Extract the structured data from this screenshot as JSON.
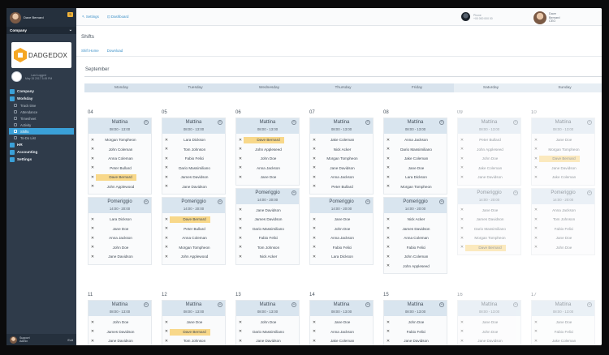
{
  "sidebar": {
    "user_name": "Dave Bernard",
    "notification_count": "5",
    "company_label": "Company",
    "logo_text": "DADGEDOX",
    "login_text": "Last Logged\nMay 15 2017 3:45 PM",
    "nav": [
      {
        "label": "Company",
        "icon": "building-icon"
      },
      {
        "label": "Workday",
        "icon": "briefcase-icon"
      }
    ],
    "workday_items": [
      "Track time",
      "Attendance",
      "Timesheet",
      "Activity",
      "Shifts",
      "To-Do List"
    ],
    "active_item": "Shifts",
    "nav_bottom": [
      {
        "label": "HR",
        "icon": "people-icon"
      },
      {
        "label": "Accounting",
        "icon": "calculator-icon"
      },
      {
        "label": "Settings",
        "icon": "gear-icon"
      }
    ],
    "bottom_user": "Support\nAdmin",
    "exit_label": "Exit"
  },
  "topbar": {
    "breadcrumb_settings": "Settings",
    "breadcrumb_dashboard": "Dashboard",
    "center_text": "Phone\n+00 000 000 00",
    "right_user": "Dave\nBernard\nCEO"
  },
  "page": {
    "title": "Shifts",
    "tabs": [
      "Shift Home",
      "Download"
    ],
    "month": "September",
    "weekdays": [
      "Monday",
      "Tuesday",
      "Wednesday",
      "Thursday",
      "Friday",
      "Saturday",
      "Sunday"
    ]
  },
  "accent_color": "#3aa0d8",
  "highlight_color": "#f8d88a",
  "week1": [
    {
      "date": "04",
      "dim": false,
      "shifts": [
        {
          "name": "Mattina",
          "time": "08:00 - 13:00",
          "people": [
            "Morgan Tompheon",
            "John Coleman",
            "Anna Coleman",
            "Peter Bullard",
            "Dave Bernard",
            "John Applewood"
          ],
          "highlight": 4
        },
        {
          "name": "Pomeriggio",
          "time": "14:00 - 20:00",
          "people": [
            "Lara Dickson",
            "Jane Doe",
            "Anna Jackson",
            "John Doe",
            "Jane Davidson"
          ],
          "highlight": -1
        }
      ]
    },
    {
      "date": "05",
      "dim": false,
      "shifts": [
        {
          "name": "Mattina",
          "time": "08:00 - 13:00",
          "people": [
            "Lara Dickson",
            "Tom Johnson",
            "Fabio Felici",
            "Dario Massimiliano",
            "James Davidson",
            "Jane Davidson"
          ],
          "highlight": -1
        },
        {
          "name": "Pomeriggio",
          "time": "14:00 - 20:00",
          "people": [
            "Dave Bernard",
            "Peter Bullard",
            "Anna Coleman",
            "Morgan Tompheon",
            "John Applewood"
          ],
          "highlight": 0
        }
      ]
    },
    {
      "date": "06",
      "dim": false,
      "shifts": [
        {
          "name": "Mattina",
          "time": "08:00 - 13:00",
          "people": [
            "Dave Bernard",
            "John Appleseed",
            "John Doe",
            "Anna Jackson",
            "Jane Doe"
          ],
          "highlight": 0
        },
        {
          "name": "Pomeriggio",
          "time": "14:00 - 20:00",
          "people": [
            "Jane Davidson",
            "James Davidson",
            "Dario Massimiliano",
            "Fabio Felici",
            "Tom Johnson",
            "Nick Acker"
          ],
          "highlight": -1
        }
      ]
    },
    {
      "date": "07",
      "dim": false,
      "shifts": [
        {
          "name": "Mattina",
          "time": "08:00 - 13:00",
          "people": [
            "Jake Coleman",
            "Nick Acker",
            "Morgan Tompheon",
            "Jane Davidson",
            "Anna Jackson",
            "Peter Bullard"
          ],
          "highlight": -1
        },
        {
          "name": "Pomeriggio",
          "time": "14:00 - 20:00",
          "people": [
            "Jane Doe",
            "John Doe",
            "Anna Jackson",
            "Fabio Felici",
            "Lara Dickson"
          ],
          "highlight": -1
        }
      ]
    },
    {
      "date": "08",
      "dim": false,
      "shifts": [
        {
          "name": "Mattina",
          "time": "08:00 - 13:00",
          "people": [
            "Anna Jackson",
            "Dario Massimiliano",
            "Jake Coleman",
            "Jane Doe",
            "Lara Dickson",
            "Morgan Tompheon"
          ],
          "highlight": -1
        },
        {
          "name": "Pomeriggio",
          "time": "14:00 - 20:00",
          "people": [
            "Nick Acker",
            "James Davidson",
            "Anna Coleman",
            "Fabio Felici",
            "John Coleman",
            "John Appleseed"
          ],
          "highlight": -1
        }
      ]
    },
    {
      "date": "09",
      "dim": true,
      "shifts": [
        {
          "name": "Mattina",
          "time": "08:00 - 13:00",
          "people": [
            "Peter Bullard",
            "John Appleseed",
            "John Doe",
            "Jake Coleman",
            "Jane Davidson"
          ],
          "highlight": -1
        },
        {
          "name": "Pomeriggio",
          "time": "14:00 - 20:00",
          "people": [
            "Jane Doe",
            "James Davidson",
            "Dario Massimiliano",
            "Morgan Tompheon",
            "Dave Bernard"
          ],
          "highlight": 4
        }
      ]
    },
    {
      "date": "10",
      "dim": true,
      "shifts": [
        {
          "name": "Mattina",
          "time": "08:00 - 13:00",
          "people": [
            "Jane Doe",
            "Morgan Tompheon",
            "Dave Bernard",
            "Jane Davidson",
            "Jake Coleman"
          ],
          "highlight": 2
        },
        {
          "name": "Pomeriggio",
          "time": "14:00 - 20:00",
          "people": [
            "Anna Jackson",
            "Tom Johnson",
            "Fabio Felici",
            "Jane Doe",
            "John Doe"
          ],
          "highlight": -1
        }
      ]
    }
  ],
  "week2": [
    {
      "date": "11",
      "dim": false,
      "shifts": [
        {
          "name": "Mattina",
          "time": "08:00 - 13:00",
          "people": [
            "John Doe",
            "James Davidson",
            "Jane Davidson"
          ],
          "highlight": -1
        }
      ]
    },
    {
      "date": "12",
      "dim": false,
      "shifts": [
        {
          "name": "Mattina",
          "time": "08:00 - 13:00",
          "people": [
            "Jane Doe",
            "Dave Bernard",
            "Tom Johnson"
          ],
          "highlight": 1
        }
      ]
    },
    {
      "date": "13",
      "dim": false,
      "shifts": [
        {
          "name": "Mattina",
          "time": "08:00 - 13:00",
          "people": [
            "John Doe",
            "Dario Massimiliano",
            "Jane Davidson"
          ],
          "highlight": -1
        }
      ]
    },
    {
      "date": "14",
      "dim": false,
      "shifts": [
        {
          "name": "Mattina",
          "time": "08:00 - 13:00",
          "people": [
            "Jane Doe",
            "Anna Jackson",
            "Jake Coleman"
          ],
          "highlight": -1
        }
      ]
    },
    {
      "date": "15",
      "dim": false,
      "shifts": [
        {
          "name": "Mattina",
          "time": "08:00 - 13:00",
          "people": [
            "John Doe",
            "Fabio Felici",
            "Jane Davidson"
          ],
          "highlight": -1
        }
      ]
    },
    {
      "date": "16",
      "dim": true,
      "shifts": [
        {
          "name": "Mattina",
          "time": "08:00 - 13:00",
          "people": [
            "Jane Doe",
            "John Doe",
            "Jane Davidson"
          ],
          "highlight": -1
        }
      ]
    },
    {
      "date": "17",
      "dim": true,
      "shifts": [
        {
          "name": "Mattina",
          "time": "08:00 - 13:00",
          "people": [
            "Jane Doe",
            "Fabio Felici",
            "Jake Coleman"
          ],
          "highlight": -1
        }
      ]
    }
  ]
}
